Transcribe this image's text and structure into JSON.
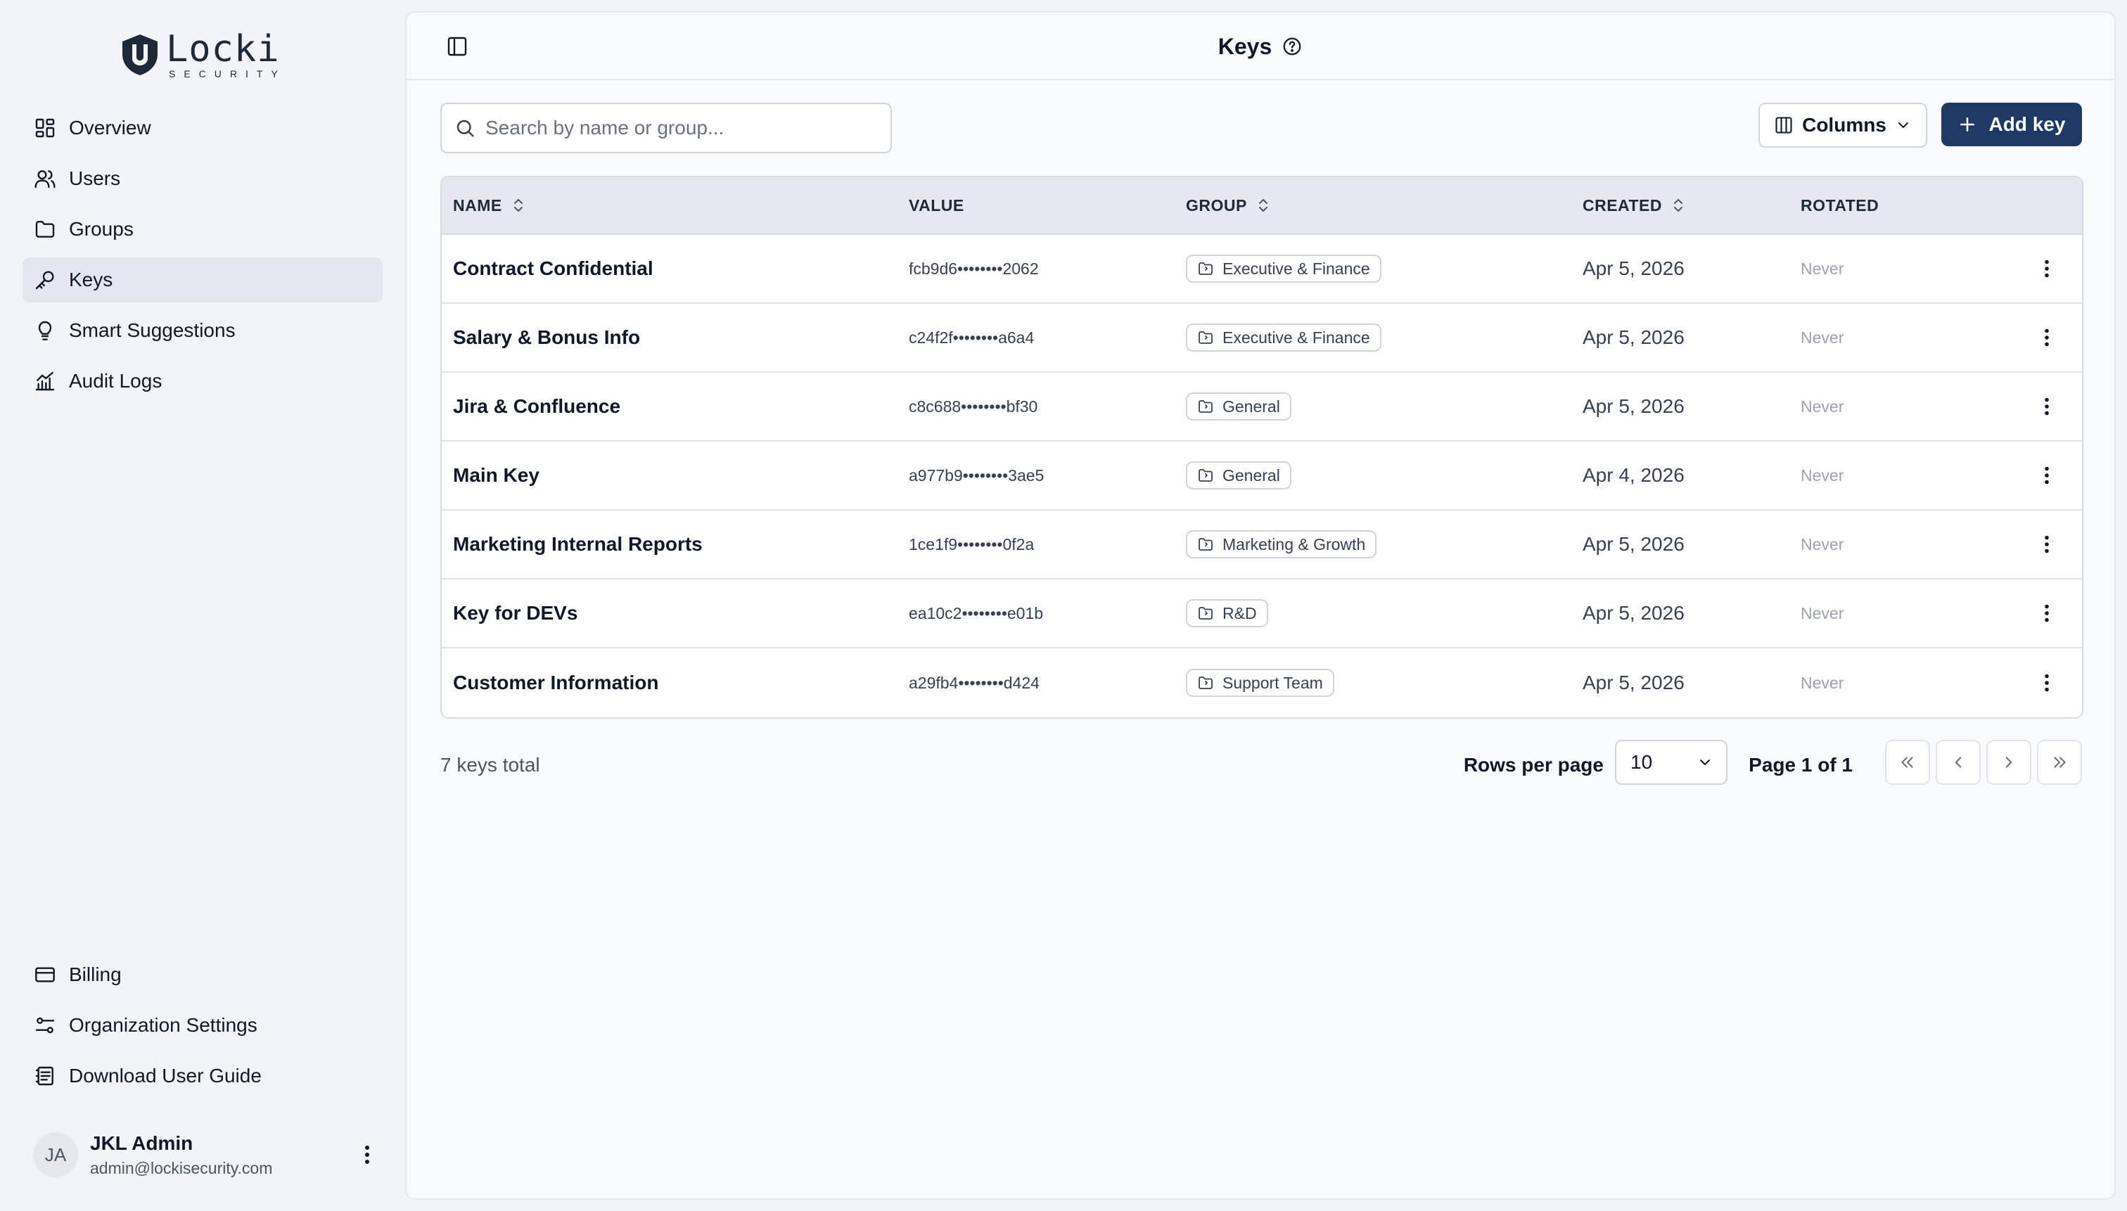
{
  "brand": {
    "name": "Locki",
    "tagline": "SECURITY"
  },
  "sidebar": {
    "items": [
      {
        "label": "Overview",
        "icon": "dashboard-icon"
      },
      {
        "label": "Users",
        "icon": "users-icon"
      },
      {
        "label": "Groups",
        "icon": "folder-icon"
      },
      {
        "label": "Keys",
        "icon": "key-icon",
        "active": true
      },
      {
        "label": "Smart Suggestions",
        "icon": "lightbulb-icon"
      },
      {
        "label": "Audit Logs",
        "icon": "chart-icon"
      }
    ],
    "bottom_items": [
      {
        "label": "Billing",
        "icon": "credit-card-icon"
      },
      {
        "label": "Organization Settings",
        "icon": "sliders-icon"
      },
      {
        "label": "Download User Guide",
        "icon": "book-icon"
      }
    ]
  },
  "user": {
    "initials": "JA",
    "name": "JKL Admin",
    "email": "admin@lockisecurity.com"
  },
  "header": {
    "title": "Keys"
  },
  "toolbar": {
    "search_placeholder": "Search by name or group...",
    "columns_label": "Columns",
    "add_label": "Add key"
  },
  "table": {
    "columns": [
      "NAME",
      "VALUE",
      "GROUP",
      "CREATED",
      "ROTATED"
    ],
    "rows": [
      {
        "name": "Contract Confidential",
        "value": "fcb9d6••••••••2062",
        "group": "Executive & Finance",
        "created": "Apr 5, 2026",
        "rotated": "Never"
      },
      {
        "name": "Salary & Bonus Info",
        "value": "c24f2f••••••••a6a4",
        "group": "Executive & Finance",
        "created": "Apr 5, 2026",
        "rotated": "Never"
      },
      {
        "name": "Jira & Confluence",
        "value": "c8c688••••••••bf30",
        "group": "General",
        "created": "Apr 5, 2026",
        "rotated": "Never"
      },
      {
        "name": "Main Key",
        "value": "a977b9••••••••3ae5",
        "group": "General",
        "created": "Apr 4, 2026",
        "rotated": "Never"
      },
      {
        "name": "Marketing Internal Reports",
        "value": "1ce1f9••••••••0f2a",
        "group": "Marketing & Growth",
        "created": "Apr 5, 2026",
        "rotated": "Never"
      },
      {
        "name": "Key for DEVs",
        "value": "ea10c2••••••••e01b",
        "group": "R&D",
        "created": "Apr 5, 2026",
        "rotated": "Never"
      },
      {
        "name": "Customer Information",
        "value": "a29fb4••••••••d424",
        "group": "Support Team",
        "created": "Apr 5, 2026",
        "rotated": "Never"
      }
    ]
  },
  "footer": {
    "total": "7 keys total",
    "rows_per_page_label": "Rows per page",
    "rows_per_page_value": "10",
    "page_label": "Page 1 of 1"
  },
  "colors": {
    "accent": "#1e3a64",
    "background": "#f2f4f7",
    "panel": "#f9fafb"
  }
}
